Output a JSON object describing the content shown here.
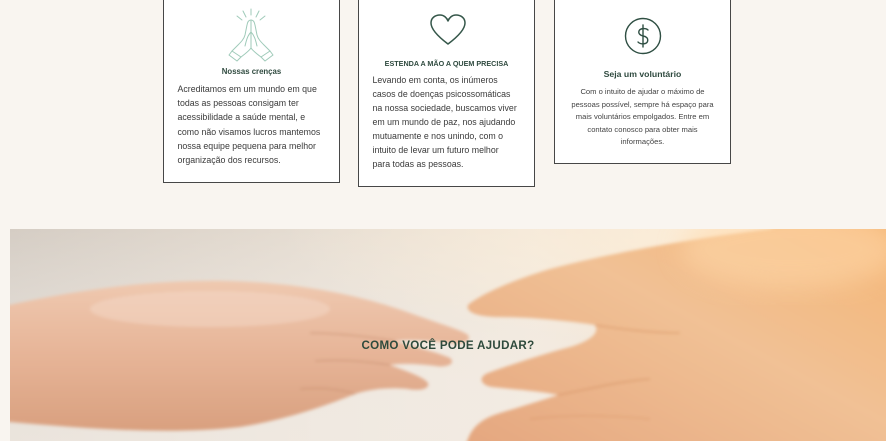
{
  "colors": {
    "background": "#f9f5f0",
    "card_background": "#ffffff",
    "card_border": "#474747",
    "accent_green": "#2f4a3f",
    "icon_light_green": "#9fcab9",
    "body_text": "#3a3a3a"
  },
  "cards": [
    {
      "icon": "praying-hands-icon",
      "title": "Nossas crenças",
      "lines": [
        "Acreditamos em um mundo em que",
        "todas as pessoas consigam ter",
        "acessibilidade a saúde mental, e",
        "como não visamos lucros mantemos",
        "nossa equipe pequena para melhor",
        "organização dos recursos."
      ]
    },
    {
      "icon": "heart-icon",
      "title": "ESTENDA A MÃO A QUEM PRECISA",
      "lines": [
        "Levando em conta, os inúmeros",
        "casos de doenças psicossomáticas",
        "na nossa sociedade, buscamos viver",
        "em um mundo de paz, nos ajudando",
        "mutuamente e nos unindo, com o",
        "intuito de levar um futuro melhor",
        "para todas as pessoas."
      ]
    },
    {
      "icon": "dollar-coin-icon",
      "title": "Seja um voluntário",
      "lines": [
        "Com o intuito de ajudar o máximo de",
        "pessoas possível, sempre há espaço para",
        "mais voluntários empolgados. Entre em",
        "contato conosco para obter mais",
        "informações."
      ]
    }
  ],
  "banner": {
    "title": "COMO VOCÊ PODE AJUDAR?"
  }
}
